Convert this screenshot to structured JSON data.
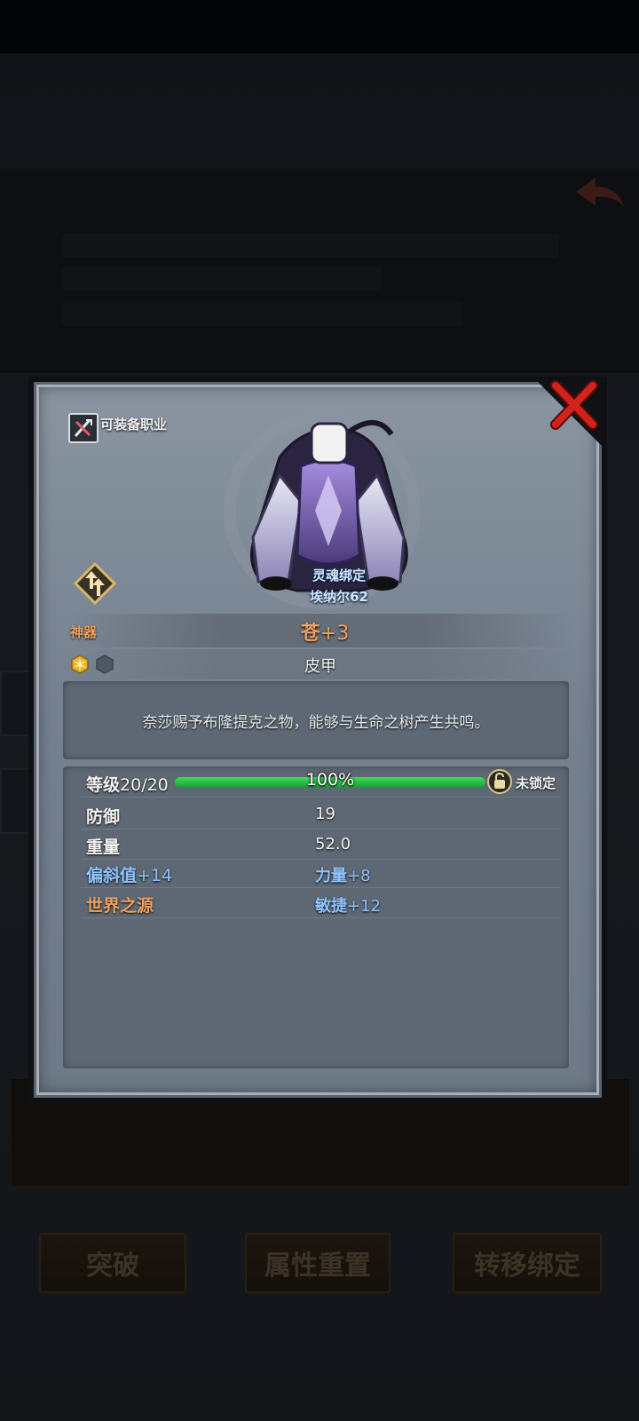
{
  "background": {
    "buttons": [
      "突破",
      "属性重置",
      "转移绑定"
    ]
  },
  "modal": {
    "equip_class_label": "可装备职业",
    "bind_status": "灵魂绑定",
    "owner": "埃纳尔62",
    "category": "神器",
    "item_name": "苍",
    "item_plus": "+3",
    "item_type": "皮甲",
    "description": "奈莎赐予布隆提克之物，能够与生命之树产生共鸣。",
    "stats": {
      "level_label": "等级",
      "level_value": "20/20",
      "progress_percent": 100,
      "progress_text": "100%",
      "lock_label": "未锁定",
      "defense_label": "防御",
      "defense_value": "19",
      "weight_label": "重量",
      "weight_value": "52.0",
      "deflect_label": "偏斜值",
      "deflect_value": "+14",
      "strength_label": "力量",
      "strength_value": "+8",
      "world_source_label": "世界之源",
      "agility_label": "敏捷",
      "agility_value": "+12"
    }
  },
  "colors": {
    "accent_orange": "#f0a25c",
    "accent_blue": "#8fc4ff",
    "progress_green": "#3fdd5a",
    "close_red": "#d3221c"
  }
}
